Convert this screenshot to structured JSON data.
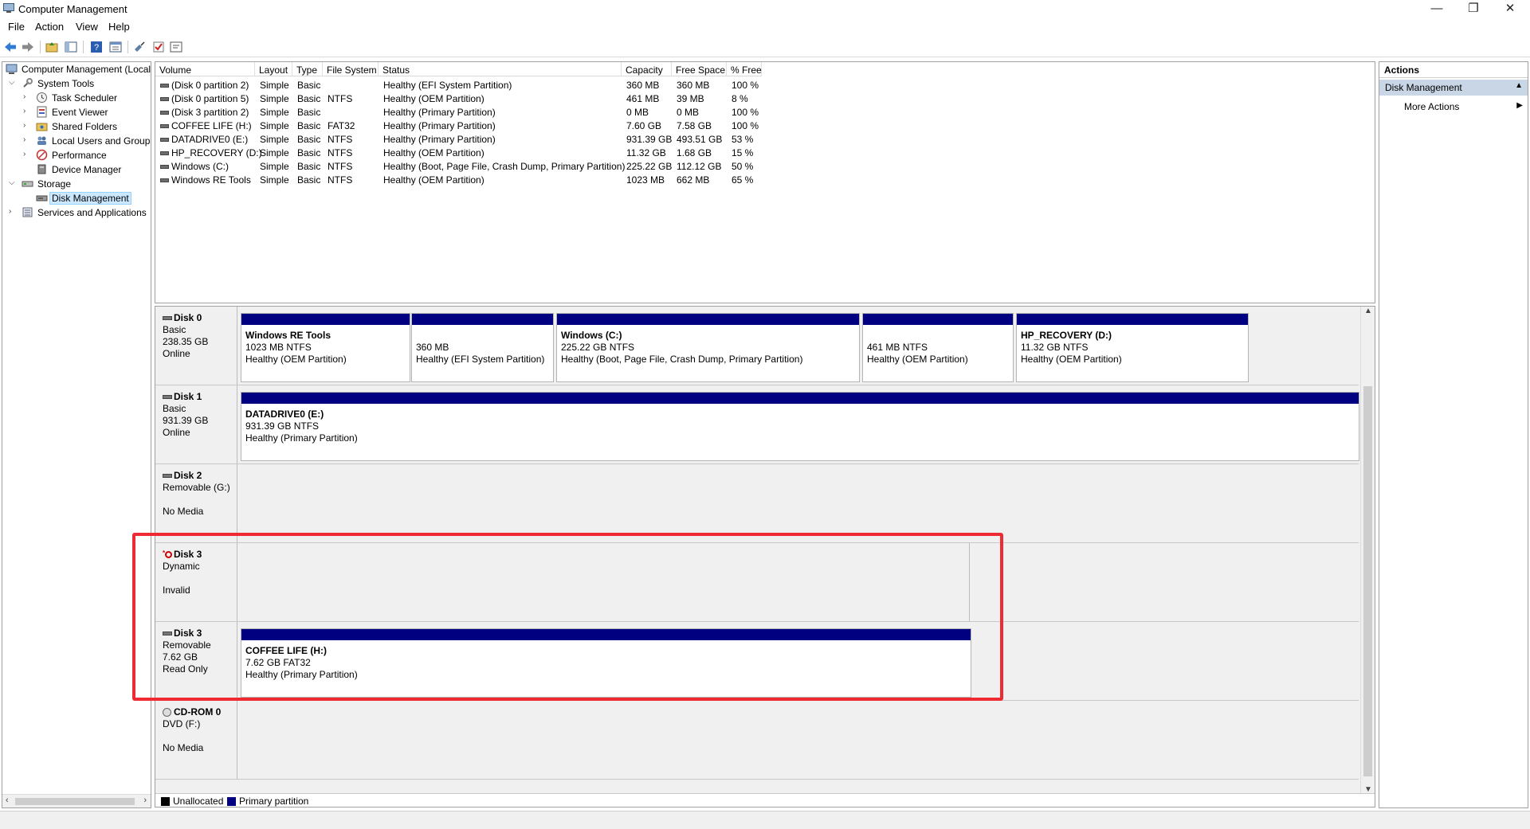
{
  "window": {
    "title": "Computer Management",
    "minimize": "—",
    "restore": "❐",
    "close": "✕"
  },
  "menu": [
    "File",
    "Action",
    "View",
    "Help"
  ],
  "tree": [
    {
      "label": "Computer Management (Local",
      "icon": "computer-management-icon"
    },
    {
      "label": "System Tools",
      "icon": "tools-icon"
    },
    {
      "label": "Task Scheduler",
      "icon": "clock-icon"
    },
    {
      "label": "Event Viewer",
      "icon": "event-viewer-icon"
    },
    {
      "label": "Shared Folders",
      "icon": "shared-folder-icon"
    },
    {
      "label": "Local Users and Groups",
      "icon": "users-icon"
    },
    {
      "label": "Performance",
      "icon": "performance-icon"
    },
    {
      "label": "Device Manager",
      "icon": "device-manager-icon"
    },
    {
      "label": "Storage",
      "icon": "storage-icon"
    },
    {
      "label": "Disk Management",
      "icon": "disk-management-icon"
    },
    {
      "label": "Services and Applications",
      "icon": "services-icon"
    }
  ],
  "volume_columns": [
    "Volume",
    "Layout",
    "Type",
    "File System",
    "Status",
    "Capacity",
    "Free Space",
    "% Free"
  ],
  "volumes": [
    [
      "(Disk 0 partition 2)",
      "Simple",
      "Basic",
      "",
      "Healthy (EFI System Partition)",
      "360 MB",
      "360 MB",
      "100 %"
    ],
    [
      "(Disk 0 partition 5)",
      "Simple",
      "Basic",
      "NTFS",
      "Healthy (OEM Partition)",
      "461 MB",
      "39 MB",
      "8 %"
    ],
    [
      "(Disk 3 partition 2)",
      "Simple",
      "Basic",
      "",
      "Healthy (Primary Partition)",
      "0 MB",
      "0 MB",
      "100 %"
    ],
    [
      "COFFEE LIFE (H:)",
      "Simple",
      "Basic",
      "FAT32",
      "Healthy (Primary Partition)",
      "7.60 GB",
      "7.58 GB",
      "100 %"
    ],
    [
      "DATADRIVE0 (E:)",
      "Simple",
      "Basic",
      "NTFS",
      "Healthy (Primary Partition)",
      "931.39 GB",
      "493.51 GB",
      "53 %"
    ],
    [
      "HP_RECOVERY (D:)",
      "Simple",
      "Basic",
      "NTFS",
      "Healthy (OEM Partition)",
      "11.32 GB",
      "1.68 GB",
      "15 %"
    ],
    [
      "Windows  (C:)",
      "Simple",
      "Basic",
      "NTFS",
      "Healthy (Boot, Page File, Crash Dump, Primary Partition)",
      "225.22 GB",
      "112.12 GB",
      "50 %"
    ],
    [
      "Windows RE Tools",
      "Simple",
      "Basic",
      "NTFS",
      "Healthy (OEM Partition)",
      "1023 MB",
      "662 MB",
      "65 %"
    ]
  ],
  "disks": [
    {
      "name": "Disk 0",
      "line1": "Basic",
      "line2": "238.35 GB",
      "line3": "Online",
      "icon": "disk-icon",
      "partitions": [
        {
          "name": "Windows RE Tools",
          "size": "1023 MB NTFS",
          "status": "Healthy (OEM Partition)"
        },
        {
          "name": "",
          "size": "360 MB",
          "status": "Healthy (EFI System Partition)"
        },
        {
          "name": "Windows  (C:)",
          "size": "225.22 GB NTFS",
          "status": "Healthy (Boot, Page File, Crash Dump, Primary Partition)"
        },
        {
          "name": "",
          "size": "461 MB NTFS",
          "status": "Healthy (OEM Partition)"
        },
        {
          "name": "HP_RECOVERY  (D:)",
          "size": "11.32 GB NTFS",
          "status": "Healthy (OEM Partition)"
        }
      ]
    },
    {
      "name": "Disk 1",
      "line1": "Basic",
      "line2": "931.39 GB",
      "line3": "Online",
      "icon": "disk-icon",
      "partitions": [
        {
          "name": "DATADRIVE0  (E:)",
          "size": "931.39 GB NTFS",
          "status": "Healthy (Primary Partition)"
        }
      ]
    },
    {
      "name": "Disk 2",
      "line1": "Removable (G:)",
      "line2": "",
      "line3": "No Media",
      "icon": "disk-icon",
      "partitions": []
    },
    {
      "name": "Disk 3",
      "line1": "Dynamic",
      "line2": "",
      "line3": "Invalid",
      "icon": "invalid-disk-icon",
      "partitions": []
    },
    {
      "name": "Disk 3",
      "line1": "Removable",
      "line2": "7.62 GB",
      "line3": "Read Only",
      "icon": "disk-icon",
      "partitions": [
        {
          "name": "COFFEE LIFE  (H:)",
          "size": "7.62 GB FAT32",
          "status": "Healthy (Primary Partition)"
        }
      ]
    },
    {
      "name": "CD-ROM 0",
      "line1": "DVD (F:)",
      "line2": "",
      "line3": "No Media",
      "icon": "cdrom-icon",
      "partitions": []
    }
  ],
  "legend": [
    {
      "label": "Unallocated",
      "color": "#000000"
    },
    {
      "label": "Primary partition",
      "color": "#000080"
    }
  ],
  "actions": {
    "header": "Actions",
    "section": "Disk Management",
    "more": "More Actions"
  },
  "colors": {
    "partition_header": "#000080",
    "highlight": "#ee2a32",
    "actions_section": "#c8d6e6"
  }
}
